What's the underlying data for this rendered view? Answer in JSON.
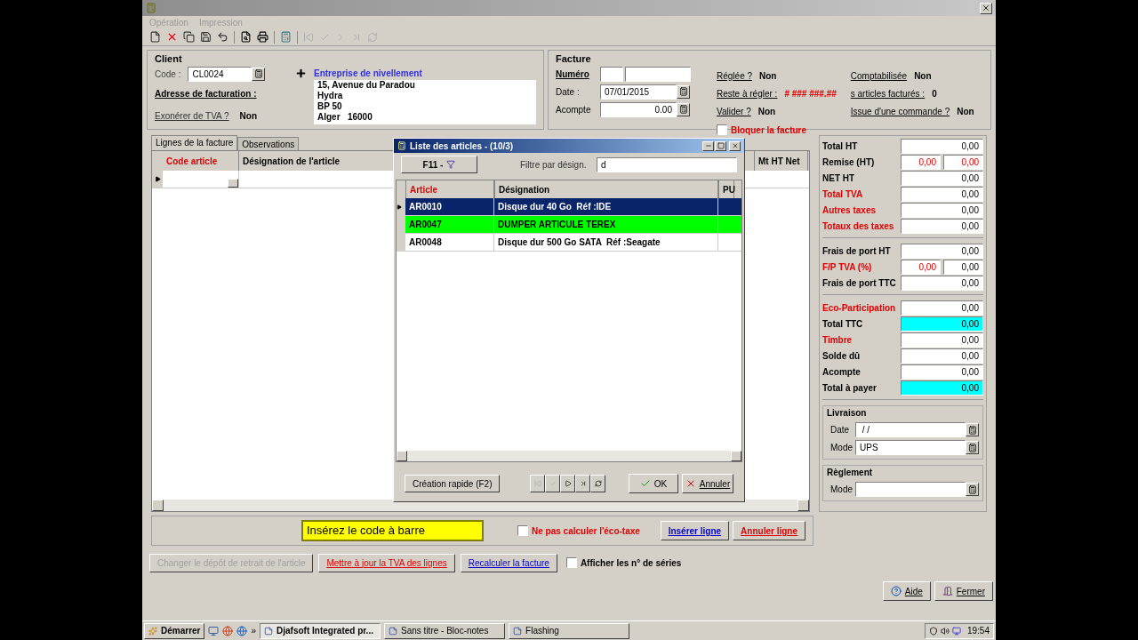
{
  "window": {
    "menu": [
      "Opération",
      "Impression"
    ]
  },
  "client": {
    "title": "Client",
    "code_label": "Code :",
    "code": "CL0024",
    "name": "Entreprise de nivellement",
    "billing_label": "Adresse de facturation :",
    "address": [
      "15, Avenue du Paradou",
      "Hydra",
      "BP 50",
      "Alger   16000"
    ],
    "vat_label": "Exonérer de TVA ?",
    "vat": "Non"
  },
  "invoice": {
    "title": "Facture",
    "number_label": "Numéro",
    "date_label": "Date :",
    "date": "07/01/2015",
    "deposit_label": "Acompte",
    "deposit": "0.00",
    "status": [
      {
        "label": "Réglée ?",
        "value": "Non",
        "alert": false
      },
      {
        "label": "Comptabilisée",
        "value": "Non",
        "alert": false
      },
      {
        "label": "Reste à régler :",
        "value": "# ### ###.##",
        "alert": true
      },
      {
        "label": "s articles facturés :",
        "value": "0",
        "alert": false
      },
      {
        "label": "Valider ?",
        "value": "Non",
        "alert": false
      },
      {
        "label": "Issue d'une commande ?",
        "value": "Non",
        "alert": false
      }
    ],
    "lock": {
      "label": "Bloquer la facture",
      "checked": false
    }
  },
  "tabs": [
    {
      "label": "Lignes de la facture",
      "selected": true
    },
    {
      "label": "Observations",
      "selected": false
    }
  ],
  "grid": {
    "columns": [
      {
        "label": "Code article",
        "required": true
      },
      {
        "label": "Désignation de l'article",
        "required": false
      },
      {
        "label": "Mt HT Net",
        "required": false
      }
    ]
  },
  "picker": {
    "title": "Liste des articles - (10/3)",
    "filter_button": "F11 -",
    "filter_label": "Filtre par désign.",
    "filter_value": "d",
    "columns": [
      {
        "label": "Article",
        "required": true
      },
      {
        "label": "Désignation",
        "required": false
      },
      {
        "label": "PU",
        "required": false
      }
    ],
    "rows": [
      {
        "cells": [
          "AR0010",
          "Disque dur 40 Go  Réf :IDE"
        ],
        "selected": true
      },
      {
        "cells": [
          "AR0047",
          "DUMPER ARTICULE TEREX"
        ],
        "selected": false,
        "color": "#00ff00"
      },
      {
        "cells": [
          "AR0048",
          "Disque dur 500 Go SATA  Réf :Seagate"
        ],
        "selected": false,
        "color": "#ffffff"
      }
    ],
    "quick_create": "Création rapide (F2)",
    "ok": "OK",
    "cancel": "Annuler"
  },
  "totals": [
    [
      {
        "label": "Total HT",
        "alert": false,
        "values": [
          {
            "text": "0,00",
            "alert": false
          }
        ]
      },
      {
        "label": "Remise (HT)",
        "alert": false,
        "values": [
          {
            "text": "0,00",
            "alert": true
          },
          {
            "text": "0,00",
            "alert": true
          }
        ]
      },
      {
        "label": "NET HT",
        "alert": false,
        "values": [
          {
            "text": "0,00",
            "alert": false
          }
        ]
      },
      {
        "label": "Total TVA",
        "alert": true,
        "values": [
          {
            "text": "0,00",
            "alert": false
          }
        ]
      },
      {
        "label": "Autres taxes",
        "alert": true,
        "values": [
          {
            "text": "0,00",
            "alert": false
          }
        ]
      },
      {
        "label": "Totaux des taxes",
        "alert": true,
        "values": [
          {
            "text": "0,00",
            "alert": false
          }
        ]
      }
    ],
    [
      {
        "label": "Frais de port HT",
        "alert": false,
        "values": [
          {
            "text": "0,00",
            "alert": false
          }
        ]
      },
      {
        "label": "F/P TVA (%)",
        "alert": true,
        "values": [
          {
            "text": "0,00",
            "alert": true
          },
          {
            "text": "0,00",
            "alert": false
          }
        ]
      },
      {
        "label": "Frais de port TTC",
        "alert": false,
        "values": [
          {
            "text": "0,00",
            "alert": false
          }
        ]
      }
    ],
    [
      {
        "label": "Eco-Participation",
        "alert": true,
        "values": [
          {
            "text": "0,00",
            "alert": false
          }
        ]
      },
      {
        "label": "Total TTC",
        "alert": false,
        "accent": true,
        "values": [
          {
            "text": "0,00",
            "alert": false
          }
        ]
      },
      {
        "label": "Timbre",
        "alert": true,
        "values": [
          {
            "text": "0,00",
            "alert": false
          }
        ]
      },
      {
        "label": "Solde dû",
        "alert": false,
        "values": [
          {
            "text": "0,00",
            "alert": false
          }
        ]
      },
      {
        "label": "Acompte",
        "alert": false,
        "values": [
          {
            "text": "0,00",
            "alert": false
          }
        ]
      },
      {
        "label": "Total à payer",
        "alert": false,
        "accent": true,
        "values": [
          {
            "text": "0,00",
            "alert": false
          }
        ]
      }
    ]
  ],
  "delivery": {
    "title": "Livraison",
    "date_label": "Date",
    "date": " / /",
    "mode_label": "Mode",
    "mode": "UPS"
  },
  "payment": {
    "title": "Règlement",
    "mode_label": "Mode"
  },
  "barcode": {
    "label": "Insérez le code à barre"
  },
  "eco_tax": {
    "label": "Ne pas calculer l'éco-taxe",
    "checked": false
  },
  "line_buttons": [
    {
      "label": "Insérer ligne",
      "kind": "blue"
    },
    {
      "label": "Annuler ligne",
      "kind": "red"
    }
  ],
  "actions": [
    {
      "label": "Changer le dépôt de retrait de l'article",
      "kind": "disabled"
    },
    {
      "label": "Mettre à jour la TVA des lignes",
      "kind": "red"
    },
    {
      "label": "Recalculer la facture",
      "kind": "blue"
    }
  ],
  "serials": {
    "label": "Afficher les n° de séries",
    "checked": false
  },
  "footer_buttons": [
    "Aide",
    "Fermer"
  ],
  "taskbar": {
    "start": "Démarrer",
    "more": "»",
    "tasks": [
      {
        "label": "Djafsoft Integrated pr...",
        "selected": true
      },
      {
        "label": "Sans titre - Bloc-notes",
        "selected": false
      },
      {
        "label": "Flashing",
        "selected": false
      }
    ],
    "time": "19:54"
  }
}
